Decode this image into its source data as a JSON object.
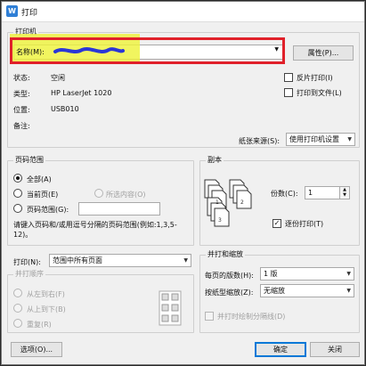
{
  "window": {
    "title": "打印",
    "app_icon": "W"
  },
  "printer": {
    "group_title": "打印机",
    "name_label": "名称(M):",
    "properties_button": "属性(P)...",
    "status_label": "状态:",
    "status_value": "空闲",
    "type_label": "类型:",
    "type_value": "HP LaserJet 1020",
    "where_label": "位置:",
    "where_value": "USB010",
    "comment_label": "备注:",
    "reverse_print": "反片打印(I)",
    "print_to_file": "打印到文件(L)",
    "paper_source_label": "纸张来源(S):",
    "paper_source_value": "使用打印机设置"
  },
  "page_range": {
    "group_title": "页码范围",
    "all": "全部(A)",
    "current": "当前页(E)",
    "selection": "所选内容(O)",
    "pages": "页码范围(G):",
    "pages_value": "",
    "hint": "请键入页码和/或用逗号分隔的页码范围(例如:1,3,5-12)。"
  },
  "copies": {
    "group_title": "副本",
    "count_label": "份数(C):",
    "count_value": "1",
    "collate": "逐份打印(T)"
  },
  "print_what": {
    "label": "打印(N):",
    "value": "范围中所有页面"
  },
  "print_order": {
    "group_title": "并打顺序",
    "left_to_right": "从左到右(F)",
    "top_to_bottom": "从上到下(B)",
    "repeat": "重复(R)"
  },
  "zoom": {
    "group_title": "并打和缩放",
    "pages_per_sheet_label": "每页的版数(H):",
    "pages_per_sheet_value": "1 版",
    "scale_label": "按纸型缩放(Z):",
    "scale_value": "无缩放",
    "draw_borders": "并打时绘制分隔线(D)"
  },
  "buttons": {
    "options": "选项(O)...",
    "ok": "确定",
    "close": "关闭"
  },
  "colors": {
    "accent": "#0078d7",
    "highlight_red": "#e0202a",
    "highlight_yellow": "#eef33c"
  }
}
